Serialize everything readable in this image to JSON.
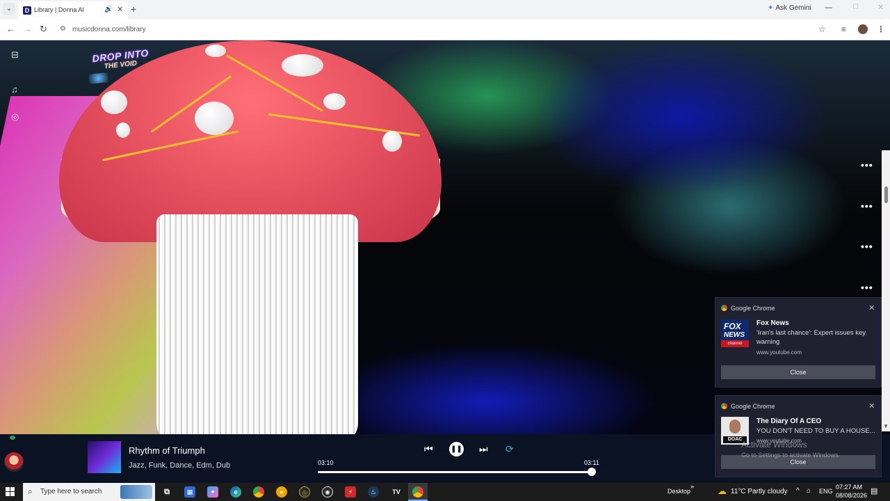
{
  "browser": {
    "tab_title": "Library | Donna AI",
    "favicon_letter": "D",
    "url": "musicdonna.com/library",
    "ask_gemini": "Ask Gemini"
  },
  "page": {
    "logo_line1": "DROP INTO",
    "logo_line2": "THE VOID"
  },
  "notifications": [
    {
      "app": "Google Chrome",
      "title": "Fox News",
      "body": "'Iran's last chance': Expert issues key warning",
      "source": "www.youtube.com",
      "close_label": "Close",
      "thumb_line1": "FOX",
      "thumb_line2": "NEWS",
      "thumb_line3": "channel"
    },
    {
      "app": "Google Chrome",
      "title": "The Diary Of A CEO",
      "body": "YOU DON'T NEED TO BUY A HOUSE...",
      "source": "www.youtube.com",
      "close_label": "Close",
      "thumb_label": "DOAC"
    }
  ],
  "watermark": {
    "line1": "Activate Windows",
    "line2": "Go to Settings to activate Windows."
  },
  "player": {
    "track_title": "Rhythm of Triumph",
    "genres": "Jazz, Funk, Dance, Edm, Dub",
    "elapsed": "03:10",
    "total": "03:11",
    "progress": 0.99
  },
  "taskbar": {
    "search_placeholder": "Type here to search",
    "desktop_label": "Desktop",
    "temperature": "11°C",
    "weather": "Partly cloudy",
    "language": "ENG",
    "time": "07:27 AM",
    "date": "08/08/2026"
  },
  "icons": {
    "speaker": "speaker-icon",
    "gear": "gear-icon",
    "more": "more-dots-icon"
  }
}
